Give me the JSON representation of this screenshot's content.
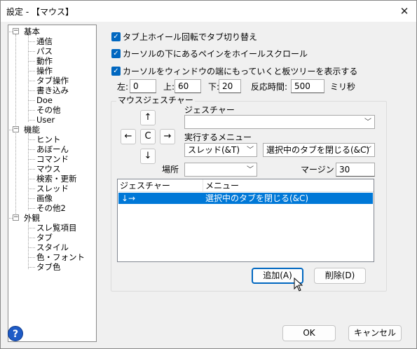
{
  "window": {
    "title": "設定 - 【マウス】",
    "close_glyph": "✕"
  },
  "tree": {
    "groups": [
      {
        "label": "基本",
        "items": [
          "通信",
          "パス",
          "動作",
          "操作",
          "タブ操作",
          "書き込み",
          "Doe",
          "その他",
          "User"
        ]
      },
      {
        "label": "機能",
        "items": [
          "ヒント",
          "あぼーん",
          "コマンド",
          "マウス",
          "検索・更新",
          "スレッド",
          "画像",
          "その他2"
        ]
      },
      {
        "label": "外観",
        "items": [
          "スレ覧項目",
          "タブ",
          "スタイル",
          "色・フォント",
          "タブ色"
        ]
      }
    ],
    "expanded_glyph": "−"
  },
  "options": {
    "wheel_tab_switch": "タブ上ホイール回転でタブ切り替え",
    "wheel_pane_scroll": "カーソルの下にあるペインをホイールスクロール",
    "edge_show_tree": "カーソルをウィンドウの端にもっていくと板ツリーを表示する",
    "check_glyph": "✓"
  },
  "edge": {
    "left_label": "左:",
    "left_value": "0",
    "top_label": "上:",
    "top_value": "60",
    "bottom_label": "下:",
    "bottom_value": "20",
    "reaction_label": "反応時間:",
    "reaction_value": "500",
    "unit": "ミリ秒"
  },
  "gesture": {
    "group_label": "マウスジェスチャー",
    "arrows": {
      "up": "↑",
      "left": "←",
      "center": "C",
      "right": "→",
      "down": "↓"
    },
    "gesture_label": "ジェスチャー",
    "gesture_value": "",
    "menu_label": "実行するメニュー",
    "menu_category": "スレッド(&T)",
    "menu_action": "選択中のタブを閉じる(&C)",
    "place_label": "場所",
    "place_value": "",
    "margin_label": "マージン",
    "margin_value": "30",
    "dropdown_glyph": "﹀"
  },
  "list": {
    "columns": [
      "ジェスチャー",
      "メニュー"
    ],
    "rows": [
      {
        "gesture": "↓→",
        "menu": "選択中のタブを閉じる(&C)"
      }
    ]
  },
  "buttons": {
    "add": "追加(A)",
    "delete": "削除(D)",
    "ok": "OK",
    "cancel": "キャンセル",
    "help": "?"
  }
}
